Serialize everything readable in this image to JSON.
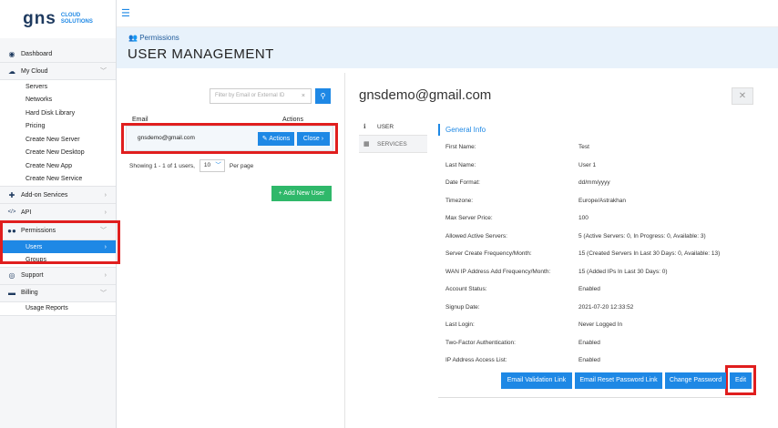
{
  "logo": {
    "brand": "gns",
    "tag1": "CLOUD",
    "tag2": "SOLUTIONS"
  },
  "sidebar": {
    "items": [
      {
        "label": "Dashboard",
        "icon": "dashboard-icon",
        "glyph": "◉"
      },
      {
        "label": "My Cloud",
        "icon": "cloud-icon",
        "glyph": "☁"
      }
    ],
    "mycloud_sub": [
      "Servers",
      "Networks",
      "Hard Disk Library",
      "Pricing",
      "Create New Server",
      "Create New Desktop",
      "Create New App",
      "Create New Service"
    ],
    "items2": [
      {
        "label": "Add-on Services",
        "icon": "addon-icon",
        "glyph": "✚"
      },
      {
        "label": "API",
        "icon": "code-icon",
        "glyph": "</>"
      },
      {
        "label": "Permissions",
        "icon": "users-icon",
        "glyph": "👥"
      }
    ],
    "perm_sub": {
      "selected": "Users",
      "other": "Groups"
    },
    "items3": [
      {
        "label": "Support",
        "icon": "support-icon",
        "glyph": "◎"
      },
      {
        "label": "Billing",
        "icon": "card-icon",
        "glyph": "▬"
      }
    ],
    "billing_sub": [
      "Usage Reports"
    ]
  },
  "header": {
    "breadcrumb": "Permissions",
    "title": "USER MANAGEMENT"
  },
  "list": {
    "filter_placeholder": "Filter by Email or External ID",
    "col_email": "Email",
    "col_actions": "Actions",
    "rows": [
      {
        "email": "gnsdemo@gmail.com"
      }
    ],
    "actions_label": "Actions",
    "close_label": "Close",
    "showing": "Showing 1 - 1 of 1 users,",
    "per_page_value": "10",
    "per_page_label": "Per page",
    "add_label": "+ Add New User"
  },
  "detail": {
    "title": "gnsdemo@gmail.com",
    "tabs": [
      {
        "label": "USER"
      },
      {
        "label": "SERVICES"
      }
    ],
    "section": "General Info",
    "fields": [
      {
        "k": "First Name:",
        "v": "Test"
      },
      {
        "k": "Last Name:",
        "v": "User 1"
      },
      {
        "k": "Date Format:",
        "v": "dd/mm/yyyy"
      },
      {
        "k": "Timezone:",
        "v": "Europe/Astrakhan"
      },
      {
        "k": "Max Server Price:",
        "v": "100"
      },
      {
        "k": "Allowed Active Servers:",
        "v": "5 (Active Servers: 0, In Progress: 0, Available: 3)"
      },
      {
        "k": "Server Create Frequency/Month:",
        "v": "15 (Created Servers In Last 30 Days: 0, Available: 13)"
      },
      {
        "k": "WAN IP Address Add Frequency/Month:",
        "v": "15 (Added IPs In Last 30 Days: 0)"
      },
      {
        "k": "Account Status:",
        "v": "Enabled"
      },
      {
        "k": "Signup Date:",
        "v": "2021-07-20 12:33:52"
      },
      {
        "k": "Last Login:",
        "v": "Never Logged In"
      },
      {
        "k": "Two-Factor Authentication:",
        "v": "Enabled"
      },
      {
        "k": "IP Address Access List:",
        "v": "Enabled"
      }
    ],
    "buttons": {
      "email_validation": "Email Validation Link",
      "email_reset": "Email Reset Password Link",
      "change_password": "Change Password",
      "edit": "Edit"
    }
  },
  "colors": {
    "accent": "#1e88e5",
    "highlight": "#e01e1e",
    "add": "#2fb86a"
  }
}
